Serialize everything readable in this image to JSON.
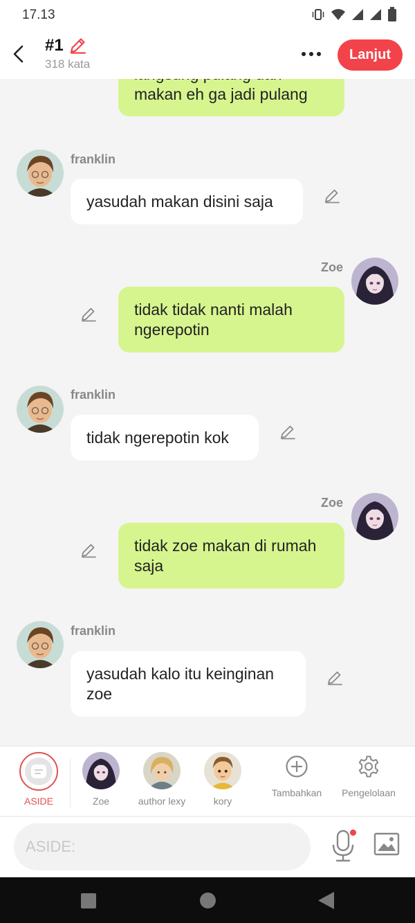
{
  "status_bar": {
    "time": "17.13",
    "icons": [
      "vibrate-icon",
      "wifi-icon",
      "signal-icon",
      "signal-icon",
      "battery-icon"
    ]
  },
  "header": {
    "title": "#1",
    "word_count": "318 kata",
    "next_label": "Lanjut",
    "accent_color": "#f2434b"
  },
  "messages": [
    {
      "sender": "",
      "side": "me",
      "text": "langsung pulang dan makan eh ga jadi pulang"
    },
    {
      "sender": "franklin",
      "side": "them",
      "text": "yasudah makan disini saja"
    },
    {
      "sender": "Zoe",
      "side": "me",
      "text": "tidak tidak nanti malah ngerepotin"
    },
    {
      "sender": "franklin",
      "side": "them",
      "text": "tidak ngerepotin kok"
    },
    {
      "sender": "Zoe",
      "side": "me",
      "text": "tidak zoe makan di rumah saja"
    },
    {
      "sender": "franklin",
      "side": "them",
      "text": "yasudah kalo itu keinginan zoe"
    }
  ],
  "characters": [
    {
      "label": "ASIDE",
      "selected": true
    },
    {
      "label": "Zoe"
    },
    {
      "label": "author lexy"
    },
    {
      "label": "kory"
    }
  ],
  "tools": {
    "add_label": "Tambahkan",
    "manage_label": "Pengelolaan"
  },
  "input": {
    "placeholder": "ASIDE:"
  },
  "colors": {
    "my_bubble": "#d6f58f",
    "their_bubble": "#ffffff",
    "background": "#f4f4f4"
  }
}
